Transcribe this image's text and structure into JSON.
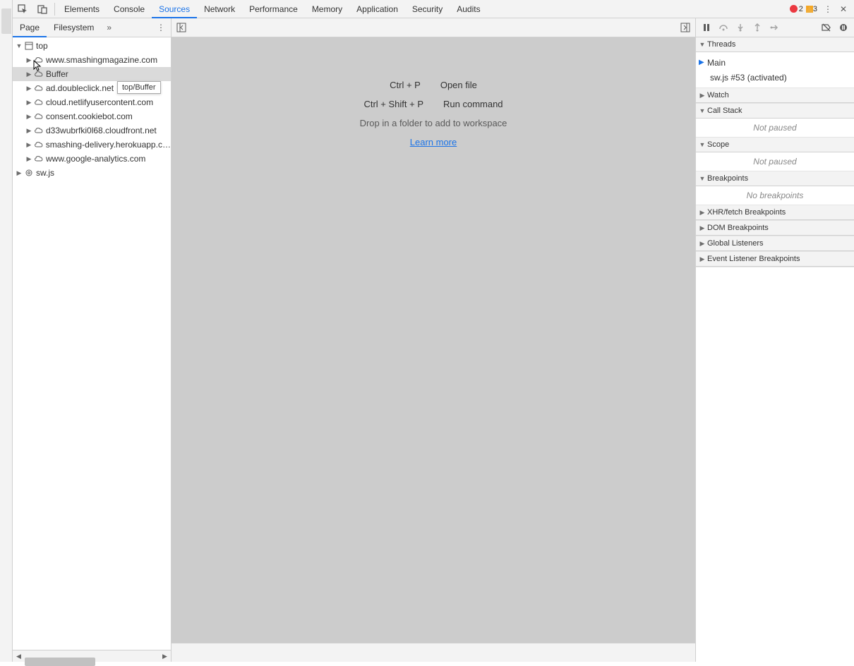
{
  "errors": {
    "error_count": "2",
    "warning_count": "3"
  },
  "main_tabs": [
    "Elements",
    "Console",
    "Sources",
    "Network",
    "Performance",
    "Memory",
    "Application",
    "Security",
    "Audits"
  ],
  "main_tabs_active": 2,
  "sidebar_tabs": {
    "page": "Page",
    "filesystem": "Filesystem"
  },
  "tree": {
    "root": "top",
    "items": [
      "www.smashingmagazine.com",
      "Buffer",
      "ad.doubleclick.net",
      "cloud.netlifyusercontent.com",
      "consent.cookiebot.com",
      "d33wubrfki0l68.cloudfront.net",
      "smashing-delivery.herokuapp.com",
      "www.google-analytics.com"
    ],
    "sw": "sw.js",
    "tooltip": "top/Buffer"
  },
  "center": {
    "hint1_key": "Ctrl + P",
    "hint1_action": "Open file",
    "hint2_key": "Ctrl + Shift + P",
    "hint2_action": "Run command",
    "drop": "Drop in a folder to add to workspace",
    "learn": "Learn more"
  },
  "debug_panels": {
    "threads": {
      "title": "Threads",
      "main": "Main",
      "sw": "sw.js #53 (activated)"
    },
    "watch": "Watch",
    "callstack": {
      "title": "Call Stack",
      "body": "Not paused"
    },
    "scope": {
      "title": "Scope",
      "body": "Not paused"
    },
    "breakpoints": {
      "title": "Breakpoints",
      "body": "No breakpoints"
    },
    "xhr": "XHR/fetch Breakpoints",
    "dom": "DOM Breakpoints",
    "global": "Global Listeners",
    "events": "Event Listener Breakpoints"
  }
}
